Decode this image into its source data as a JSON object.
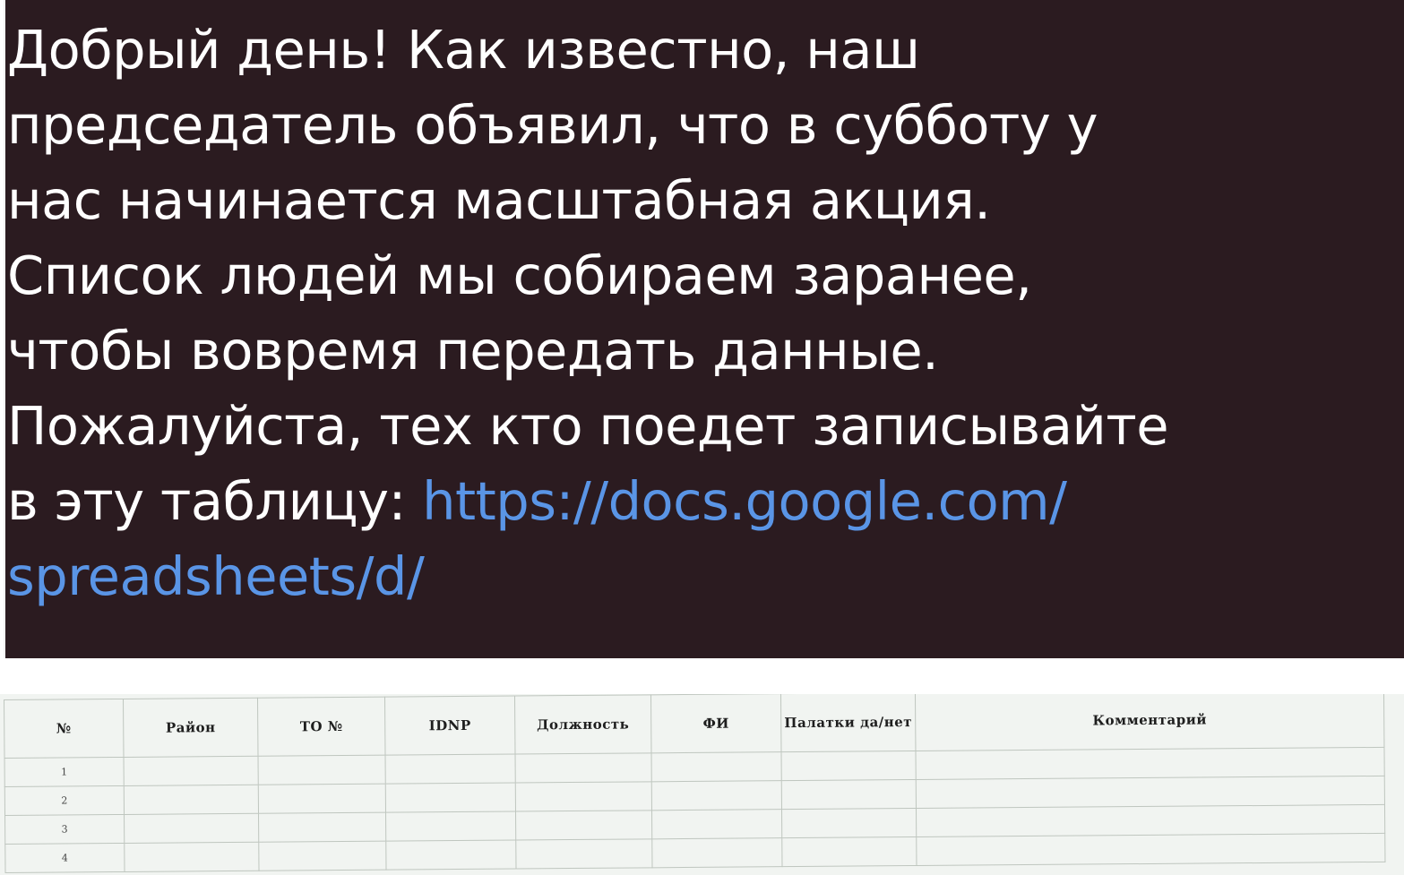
{
  "message": {
    "lines": [
      "Добрый день! Как известно, наш",
      "председатель объявил, что в субботу у",
      "нас начинается масштабная акция.",
      "Список людей мы собираем заранее,",
      "чтобы вовремя передать данные.",
      "Пожалуйста, тех кто поедет записывайте"
    ],
    "last_line_prefix": "в эту таблицу: ",
    "link_text": "https://docs.google.com/",
    "link_continuation": "spreadsheets/d/",
    "text_color": "#ffffff",
    "link_color": "#5a95e6",
    "background_color": "#2b1b20"
  },
  "sheet": {
    "headers": [
      "№",
      "Район",
      "ТО №",
      "IDNP",
      "Должность",
      "ФИ",
      "Палатки да/нет",
      "Комментарий"
    ],
    "rows": [
      [
        "1",
        "",
        "",
        "",
        "",
        "",
        "",
        ""
      ],
      [
        "2",
        "",
        "",
        "",
        "",
        "",
        "",
        ""
      ],
      [
        "3",
        "",
        "",
        "",
        "",
        "",
        "",
        ""
      ],
      [
        "4",
        "",
        "",
        "",
        "",
        "",
        "",
        ""
      ]
    ]
  }
}
